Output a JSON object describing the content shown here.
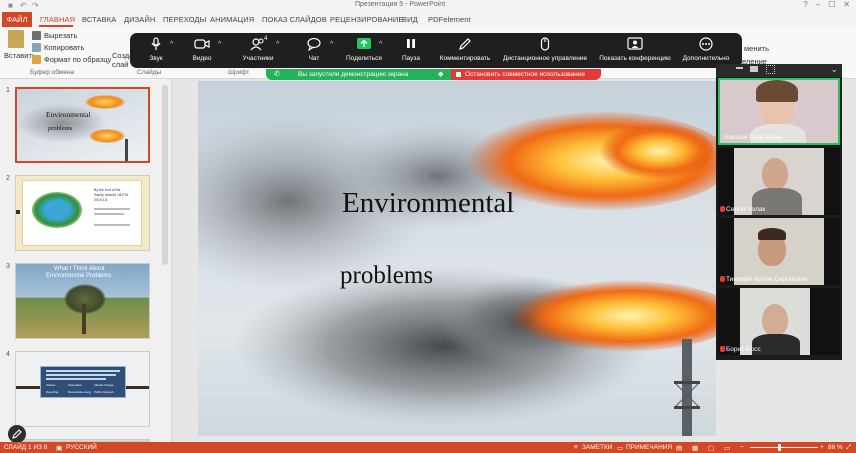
{
  "window": {
    "title": "Презентация 5 - PowerPoint"
  },
  "ribbon_tabs": [
    "ФАЙЛ",
    "ГЛАВНАЯ",
    "ВСТАВКА",
    "ДИЗАЙН",
    "ПЕРЕХОДЫ",
    "АНИМАЦИЯ",
    "ПОКАЗ СЛАЙДОВ",
    "РЕЦЕНЗИРОВАНИЕ",
    "ВИД",
    "PDFelement"
  ],
  "ribbon": {
    "paste": "Вставить",
    "cut": "Вырезать",
    "copy": "Копировать",
    "format_painter": "Формат по образцу",
    "clipboard_group": "Буфер обмена",
    "create_partial": "Созда",
    "slide_partial": "слай",
    "slides_group": "Слайды",
    "font_group": "Шрифт",
    "replace_partial": "менить",
    "select_partial": "еление"
  },
  "zoom_toolbar": {
    "items": [
      {
        "label": "Звук",
        "icon": "microphone-icon"
      },
      {
        "label": "Видео",
        "icon": "video-camera-icon"
      },
      {
        "label": "Участники",
        "icon": "participants-icon",
        "count": "4"
      },
      {
        "label": "Чат",
        "icon": "chat-icon"
      },
      {
        "label": "Поделиться",
        "icon": "share-screen-icon"
      },
      {
        "label": "Пауза",
        "icon": "pause-icon"
      },
      {
        "label": "Комментировать",
        "icon": "pen-icon"
      },
      {
        "label": "Дистанционное управление",
        "icon": "mouse-icon"
      },
      {
        "label": "Показать конференцию",
        "icon": "conference-icon"
      },
      {
        "label": "Дополнительно",
        "icon": "more-icon"
      }
    ]
  },
  "share_banner": {
    "status": "Вы запустили демонстрацию экрана",
    "stop": "Остановить совместное использование"
  },
  "thumbnails": [
    {
      "number": "1",
      "title": "Environmental",
      "subtitle": "problems"
    },
    {
      "number": "2",
      "text_a": "By the end of the",
      "text_b": "Sandy Istomin UEZTA",
      "text_c": "2019 1G"
    },
    {
      "number": "3",
      "text_a": "What I Think About",
      "text_b": "Environmental Problems"
    },
    {
      "number": "4",
      "items": [
        "Volume",
        "Information",
        "Climate change",
        "Recycling",
        "Renewable energy",
        "Public transport"
      ]
    }
  ],
  "slide": {
    "title": "Environmental",
    "subtitle": "problems"
  },
  "participants": [
    {
      "name": "Наталія Георгієвна",
      "muted": false
    },
    {
      "name": "Сергій Чолак",
      "muted": true
    },
    {
      "name": "Тимофій Артем Сергійович",
      "muted": true
    },
    {
      "name": "Борис Босс",
      "muted": true
    }
  ],
  "statusbar": {
    "slide": "СЛАЙД 1 ИЗ 8",
    "language": "РУССКИЙ",
    "notes": "ЗАМЕТКИ",
    "comments": "ПРИМЕЧАНИЯ",
    "zoom": "88 %"
  },
  "colors": {
    "accent": "#d24726",
    "zoom_bar": "#1f1f1f",
    "share_green": "#24b35a",
    "share_red": "#e53935",
    "active_speaker": "#22c55e"
  }
}
